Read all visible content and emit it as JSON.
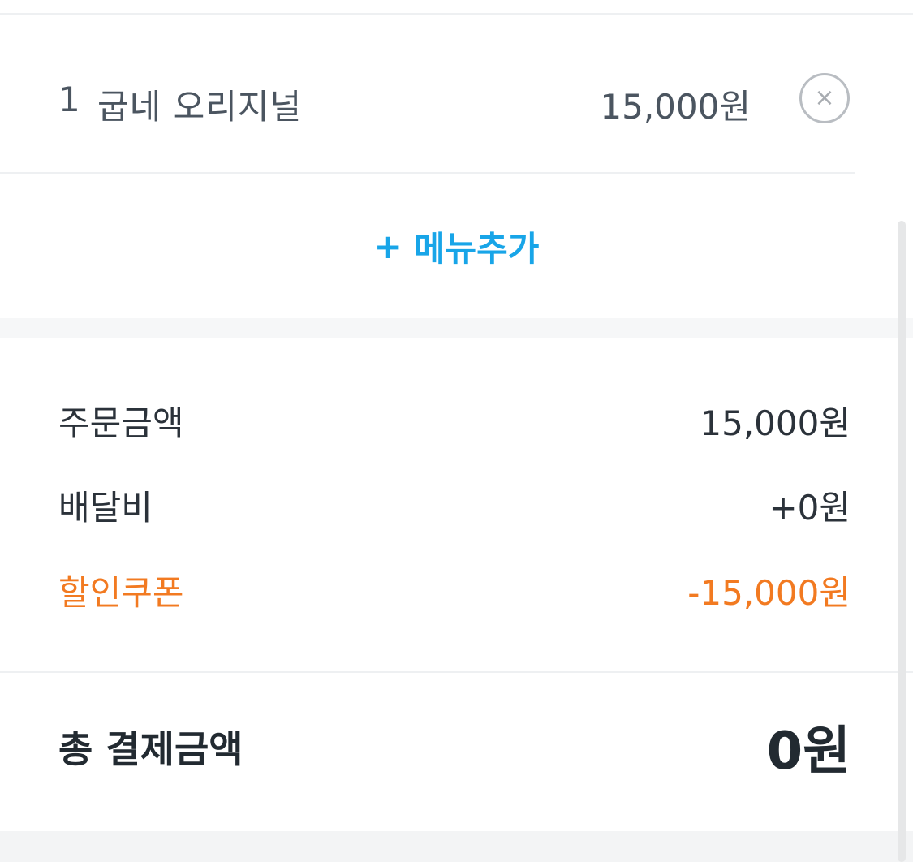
{
  "order_item": {
    "quantity": "1",
    "name": "굽네 오리지널",
    "price": "15,000원",
    "remove_glyph": "×"
  },
  "add_menu": {
    "plus": "+",
    "label": "메뉴추가"
  },
  "summary": {
    "rows": [
      {
        "label": "주문금액",
        "value": "15,000원"
      },
      {
        "label": "배달비",
        "value": "+0원"
      },
      {
        "label": "할인쿠폰",
        "value": "-15,000원"
      }
    ]
  },
  "total": {
    "label": "총 결제금액",
    "value": "0원"
  },
  "colors": {
    "accent": "#18a5e8",
    "discount": "#f27a21",
    "text": "#2b323a"
  },
  "icons": {
    "remove": "close-circle-icon"
  }
}
